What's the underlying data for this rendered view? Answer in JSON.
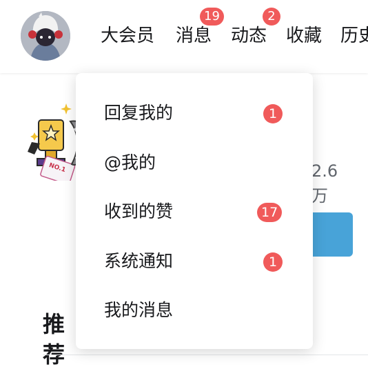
{
  "nav": {
    "items": [
      {
        "label": "大会员"
      },
      {
        "label": "消息",
        "badge": "19"
      },
      {
        "label": "动态",
        "badge": "2"
      },
      {
        "label": "收藏"
      },
      {
        "label": "历史"
      }
    ]
  },
  "background": {
    "count_text": "2.6万",
    "section_title": "推荐"
  },
  "dropdown": {
    "items": [
      {
        "label": "回复我的",
        "badge": "1"
      },
      {
        "label": "@我的"
      },
      {
        "label": "收到的赞",
        "badge": "17"
      },
      {
        "label": "系统通知",
        "badge": "1"
      },
      {
        "label": "我的消息"
      }
    ]
  },
  "colors": {
    "badge": "#f05a5a",
    "accent_button": "#48a3d8",
    "text_primary": "#18191c",
    "text_secondary": "#61666d"
  },
  "icons": {
    "avatar": "user-avatar-image",
    "decoration": "trophy-illustration"
  }
}
